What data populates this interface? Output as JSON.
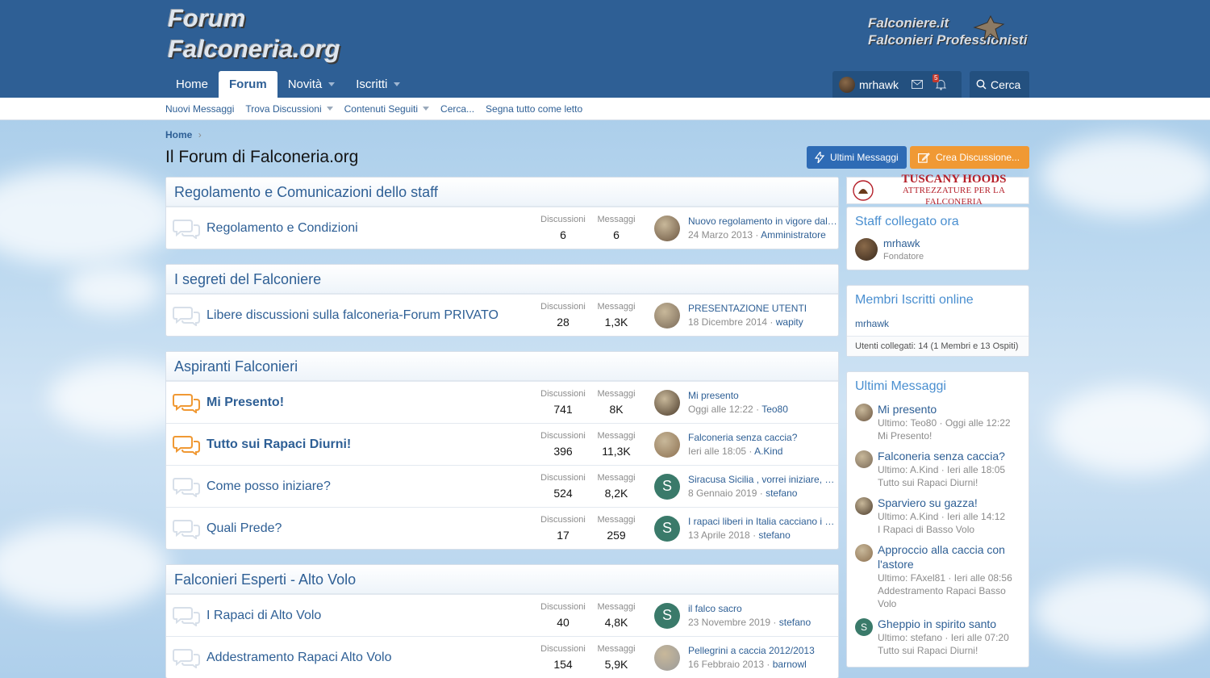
{
  "header": {
    "logo_line1": "Forum",
    "logo_line2": "Falconeria.org",
    "logo2_line1": "Falconiere.it",
    "logo2_line2": "Falconieri Professionisti"
  },
  "nav": {
    "tabs": [
      {
        "label": "Home"
      },
      {
        "label": "Forum"
      },
      {
        "label": "Novità"
      },
      {
        "label": "Iscritti"
      }
    ],
    "user": "mrhawk",
    "alerts_badge": "5",
    "search": "Cerca"
  },
  "subnav": [
    "Nuovi Messaggi",
    "Trova Discussioni",
    "Contenuti Seguiti",
    "Cerca...",
    "Segna tutto come letto"
  ],
  "breadcrumb": "Home",
  "page_title": "Il Forum di Falconeria.org",
  "buttons": {
    "latest": "Ultimi Messaggi",
    "create": "Crea Discussione..."
  },
  "labels": {
    "threads": "Discussioni",
    "messages": "Messaggi"
  },
  "categories": [
    {
      "title": "Regolamento e Comunicazioni dello staff",
      "nodes": [
        {
          "title": "Regolamento e Condizioni",
          "threads": "6",
          "messages": "6",
          "last_title": "Nuovo regolamento in vigore dal 2...",
          "last_date": "24 Marzo 2013",
          "last_user": "Amministratore",
          "avatar": "photo"
        }
      ]
    },
    {
      "title": "I segreti del Falconiere",
      "nodes": [
        {
          "title": "Libere discussioni sulla falconeria-Forum PRIVATO",
          "threads": "28",
          "messages": "1,3K",
          "last_title": "PRESENTAZIONE UTENTI",
          "last_date": "18 Dicembre 2014",
          "last_user": "wapity",
          "avatar": "photo"
        }
      ]
    },
    {
      "title": "Aspiranti Falconieri",
      "nodes": [
        {
          "title": "Mi Presento!",
          "threads": "741",
          "messages": "8K",
          "last_title": "Mi presento",
          "last_date": "Oggi alle 12:22",
          "last_user": "Teo80",
          "avatar": "photo"
        },
        {
          "title": "Tutto sui Rapaci Diurni!",
          "threads": "396",
          "messages": "11,3K",
          "last_title": "Falconeria senza caccia?",
          "last_date": "Ieri alle 18:05",
          "last_user": "A.Kind",
          "avatar": "photo"
        },
        {
          "title": "Come posso iniziare?",
          "threads": "524",
          "messages": "8,2K",
          "last_title": "Siracusa Sicilia , vorrei iniziare, qu...",
          "last_date": "8 Gennaio 2019",
          "last_user": "stefano",
          "avatar": "S"
        },
        {
          "title": "Quali Prede?",
          "threads": "17",
          "messages": "259",
          "last_title": "I rapaci liberi in Italia cacciano i co...",
          "last_date": "13 Aprile 2018",
          "last_user": "stefano",
          "avatar": "S"
        }
      ]
    },
    {
      "title": "Falconieri Esperti - Alto Volo",
      "nodes": [
        {
          "title": "I Rapaci di Alto Volo",
          "threads": "40",
          "messages": "4,8K",
          "last_title": "il falco sacro",
          "last_date": "23 Novembre 2019",
          "last_user": "stefano",
          "avatar": "S"
        },
        {
          "title": "Addestramento Rapaci Alto Volo",
          "threads": "154",
          "messages": "5,9K",
          "last_title": "Pellegrini a caccia 2012/2013",
          "last_date": "16 Febbraio 2013",
          "last_user": "barnowl",
          "avatar": "photo"
        }
      ]
    }
  ],
  "sidebar": {
    "ad": {
      "line1": "TUSCANY HOODS",
      "line2": "ATTREZZATURE PER LA FALCONERIA"
    },
    "staff": {
      "title": "Staff collegato ora",
      "name": "mrhawk",
      "role": "Fondatore"
    },
    "online": {
      "title": "Membri Iscritti online",
      "member": "mrhawk",
      "footer": "Utenti collegati: 14 (1 Membri e 13 Ospiti)"
    },
    "latest": {
      "title": "Ultimi Messaggi",
      "posts": [
        {
          "title": "Mi presento",
          "meta": "Ultimo: Teo80 · Oggi alle 12:22",
          "forum": "Mi Presento!",
          "avatar": "photo"
        },
        {
          "title": "Falconeria senza caccia?",
          "meta": "Ultimo: A.Kind · Ieri alle 18:05",
          "forum": "Tutto sui Rapaci Diurni!",
          "avatar": "photo"
        },
        {
          "title": "Sparviero su gazza!",
          "meta": "Ultimo: A.Kind · Ieri alle 14:12",
          "forum": "I Rapaci di Basso Volo",
          "avatar": "photo"
        },
        {
          "title": "Approccio alla caccia con l'astore",
          "meta": "Ultimo: FAxel81 · Ieri alle 08:56",
          "forum": "Addestramento Rapaci Basso Volo",
          "avatar": "photo"
        },
        {
          "title": "Gheppio in spirito santo",
          "meta": "Ultimo: stefano · Ieri alle 07:20",
          "forum": "Tutto sui Rapaci Diurni!",
          "avatar": "S"
        }
      ]
    }
  },
  "colors": {
    "header": "#2e5f95",
    "link": "#2e5f95",
    "accent_orange": "#f09934",
    "button_blue": "#2e6bb5",
    "avatar_s": "#3a7a6a"
  }
}
